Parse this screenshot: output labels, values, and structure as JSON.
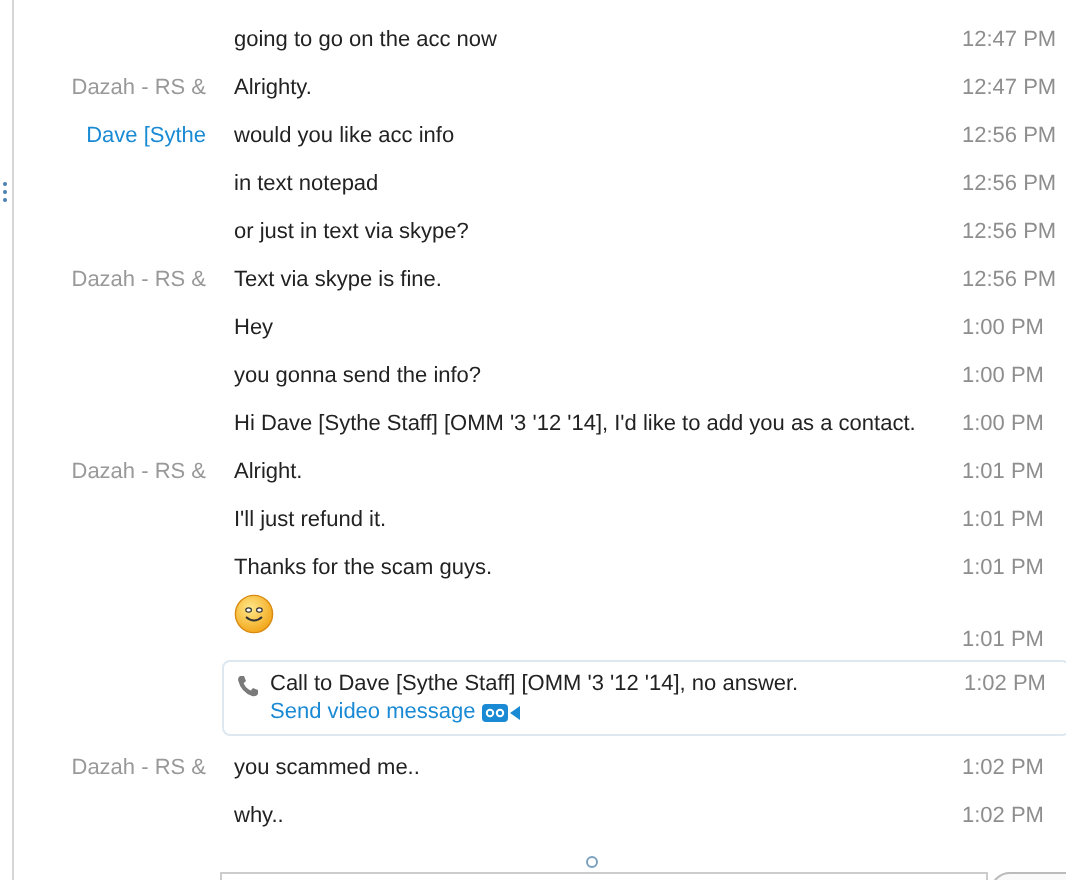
{
  "messages": [
    {
      "kind": "message",
      "text": "going to go on the acc now",
      "time": "12:47 PM"
    },
    {
      "kind": "message",
      "sender": "Dazah - RS &",
      "color": "#999999",
      "text": "Alrighty.",
      "time": "12:47 PM"
    },
    {
      "kind": "message",
      "sender": "Dave [Sythe",
      "color": "#1a8ad4",
      "text": "would you like acc info",
      "time": "12:56 PM"
    },
    {
      "kind": "message",
      "text": "in text notepad",
      "time": "12:56 PM"
    },
    {
      "kind": "message",
      "text": "or just in text via skype?",
      "time": "12:56 PM"
    },
    {
      "kind": "message",
      "sender": "Dazah - RS &",
      "color": "#999999",
      "text": "Text via skype is fine.",
      "time": "12:56 PM"
    },
    {
      "kind": "message",
      "text": "Hey",
      "time": "1:00 PM"
    },
    {
      "kind": "message",
      "text": "you gonna send the info?",
      "time": "1:00 PM"
    },
    {
      "kind": "message",
      "text": "Hi Dave [Sythe Staff] [OMM '3 '12 '14], I'd like to add you as a contact.",
      "time": "1:00 PM"
    },
    {
      "kind": "message",
      "sender": "Dazah - RS &",
      "color": "#999999",
      "text": "Alright.",
      "time": "1:01 PM"
    },
    {
      "kind": "message",
      "text": "I'll just refund it.",
      "time": "1:01 PM"
    },
    {
      "kind": "message",
      "text": "Thanks for the scam guys.",
      "time": "1:01 PM"
    },
    {
      "kind": "emoji",
      "time": "1:01 PM"
    },
    {
      "kind": "call",
      "text": "Call to Dave [Sythe Staff] [OMM '3 '12 '14], no answer.",
      "link": "Send video message",
      "time": "1:02 PM"
    },
    {
      "kind": "message",
      "sender": "Dazah - RS &",
      "color": "#999999",
      "text": "you scammed me..",
      "time": "1:02 PM"
    },
    {
      "kind": "message",
      "text": "why..",
      "time": "1:02 PM"
    }
  ]
}
